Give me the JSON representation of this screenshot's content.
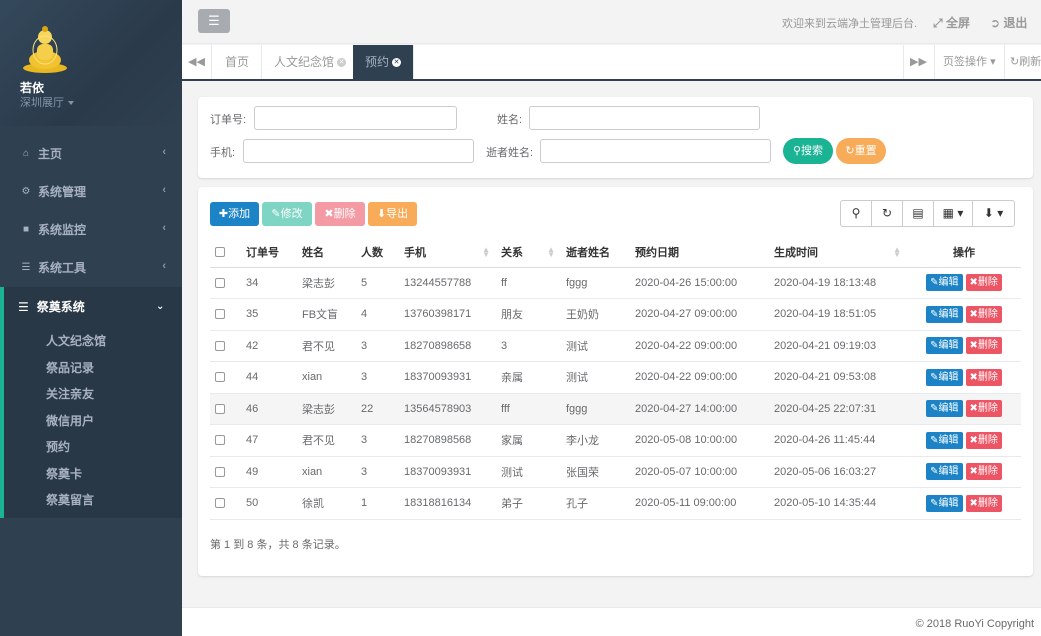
{
  "sidebar": {
    "user_name": "若依",
    "user_store": "深圳展厅",
    "menu": [
      {
        "label": "主页",
        "icon": "home-icon"
      },
      {
        "label": "系统管理",
        "icon": "gear-icon"
      },
      {
        "label": "系统监控",
        "icon": "video-icon"
      },
      {
        "label": "系统工具",
        "icon": "bars-icon"
      }
    ],
    "active_menu": {
      "label": "祭奠系统",
      "icon": "bars-icon"
    },
    "submenu": [
      "人文纪念馆",
      "祭品记录",
      "关注亲友",
      "微信用户",
      "预约",
      "祭奠卡",
      "祭奠留言"
    ]
  },
  "topbar": {
    "welcome": "欢迎来到云端净土管理后台.",
    "fullscreen": "全屏",
    "logout": "退出"
  },
  "tabs": {
    "items": [
      {
        "label": "首页"
      },
      {
        "label": "人文纪念馆"
      },
      {
        "label": "预约"
      }
    ],
    "ops": "页签操作",
    "refresh": "刷新"
  },
  "search": {
    "order_label": "订单号:",
    "name_label": "姓名:",
    "phone_label": "手机:",
    "deceased_label": "逝者姓名:",
    "search_btn": "搜索",
    "reset_btn": "重置"
  },
  "toolbar": {
    "add": "添加",
    "edit": "修改",
    "delete": "删除",
    "export": "导出"
  },
  "table": {
    "headers": [
      "订单号",
      "姓名",
      "人数",
      "手机",
      "关系",
      "逝者姓名",
      "预约日期",
      "生成时间",
      "操作"
    ],
    "rows": [
      [
        "34",
        "梁志彭",
        "5",
        "13244557788",
        "ff",
        "fggg",
        "2020-04-26 15:00:00",
        "2020-04-19 18:13:48"
      ],
      [
        "35",
        "FB文盲",
        "4",
        "13760398171",
        "朋友",
        "王奶奶",
        "2020-04-27 09:00:00",
        "2020-04-19 18:51:05"
      ],
      [
        "42",
        "君不见",
        "3",
        "18270898658",
        "3",
        "测试",
        "2020-04-22 09:00:00",
        "2020-04-21 09:19:03"
      ],
      [
        "44",
        "xian",
        "3",
        "18370093931",
        "亲属",
        "测试",
        "2020-04-22 09:00:00",
        "2020-04-21 09:53:08"
      ],
      [
        "46",
        "梁志彭",
        "22",
        "13564578903",
        "fff",
        "fggg",
        "2020-04-27 14:00:00",
        "2020-04-25 22:07:31"
      ],
      [
        "47",
        "君不见",
        "3",
        "18270898568",
        "家属",
        "李小龙",
        "2020-05-08 10:00:00",
        "2020-04-26 11:45:44"
      ],
      [
        "49",
        "xian",
        "3",
        "18370093931",
        "测试",
        "张国荣",
        "2020-05-07 10:00:00",
        "2020-05-06 16:03:27"
      ],
      [
        "50",
        "徐凯",
        "1",
        "18318816134",
        "弟子",
        "孔子",
        "2020-05-11 09:00:00",
        "2020-05-10 14:35:44"
      ]
    ],
    "edit_label": "编辑",
    "delete_label": "删除",
    "pagination": "第 1 到 8 条，共 8 条记录。"
  },
  "footer": {
    "copyright": "© 2018 RuoYi Copyright"
  },
  "colors": {
    "sidebar_bg": "#2f4050",
    "accent_green": "#1ab394",
    "primary_blue": "#1c84c6",
    "danger_red": "#ed5565",
    "warning_orange": "#f8ac59"
  }
}
